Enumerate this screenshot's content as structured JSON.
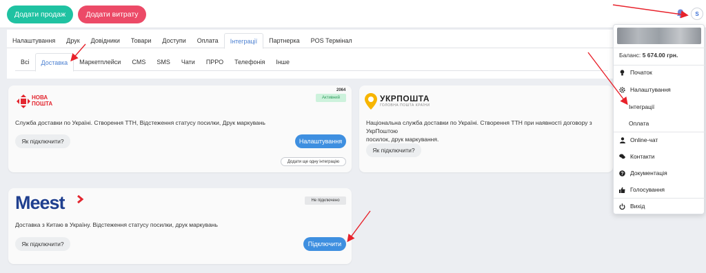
{
  "header": {
    "add_sale": "Додати продаж",
    "add_expense": "Додати витрату",
    "avatar_letter": "S",
    "accent_green": "#1fc2a2",
    "accent_red": "#ec4a67",
    "bell_icon": "bell-icon"
  },
  "tabs_main": [
    {
      "label": "Налаштування"
    },
    {
      "label": "Друк"
    },
    {
      "label": "Довідники"
    },
    {
      "label": "Товари"
    },
    {
      "label": "Доступи"
    },
    {
      "label": "Оплата"
    },
    {
      "label": "Інтеграції",
      "active": true
    },
    {
      "label": "Партнерка"
    },
    {
      "label": "POS Термінал"
    }
  ],
  "tabs_sub": [
    {
      "label": "Всі"
    },
    {
      "label": "Доставка",
      "active": true
    },
    {
      "label": "Маркетплейси"
    },
    {
      "label": "CMS"
    },
    {
      "label": "SMS"
    },
    {
      "label": "Чати"
    },
    {
      "label": "ПРРО"
    },
    {
      "label": "Телефонія"
    },
    {
      "label": "Інше"
    }
  ],
  "cards": {
    "nova_poshta": {
      "logo_line1": "НОВА",
      "logo_line2": "ПОШТА",
      "code": "2064",
      "status": "Активний",
      "description": "Служба доставки по Україні. Створення ТТН, Відстеження статусу посилки, Друк маркувань",
      "how_to": "Як підключити?",
      "settings": "Налаштування",
      "add_another": "Додати ще одну інтеграцію"
    },
    "ukrposhta": {
      "logo_title": "УКРПОШТА",
      "logo_sub": "ГОЛОВНА ПОШТА КРАЇНИ",
      "description_line1": "Національна служба доставки по Україні. Створення ТТН при наявності договору з УкрПоштою",
      "description_line2": "посилок, друк маркування.",
      "how_to": "Як підключити?"
    },
    "meest": {
      "logo": "Meest",
      "status": "Не підключено",
      "description": "Доставка з Китаю в Україну. Відстеження статусу посилки, друк маркувань",
      "how_to": "Як підключити?",
      "connect": "Підключити"
    }
  },
  "dropdown": {
    "balance_label": "Баланс:",
    "balance_value": "5 674.00 грн.",
    "items": [
      {
        "label": "Початок",
        "icon": "lightbulb-icon"
      },
      {
        "label": "Налаштування",
        "icon": "gear-icon"
      },
      {
        "label": "Інтеграції",
        "icon": ""
      },
      {
        "label": "Оплата",
        "icon": ""
      },
      {
        "label": "Online-чат",
        "icon": "user-icon"
      },
      {
        "label": "Контакти",
        "icon": "chat-icon"
      },
      {
        "label": "Документація",
        "icon": "question-icon"
      },
      {
        "label": "Голосування",
        "icon": "thumbs-up-icon"
      },
      {
        "label": "Вихід",
        "icon": "power-icon"
      }
    ]
  }
}
